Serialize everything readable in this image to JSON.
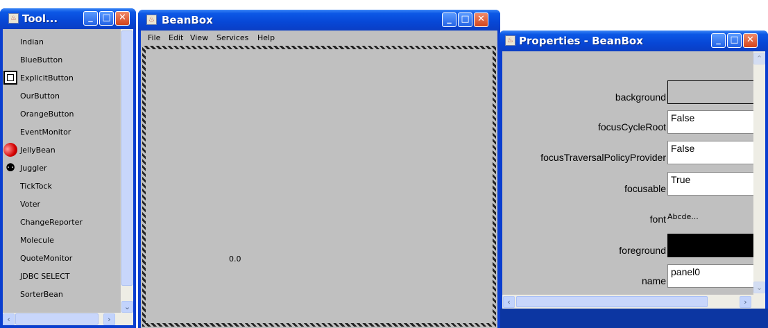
{
  "toolbox": {
    "title": "Tool...",
    "items": [
      {
        "label": "Indian",
        "icon": ""
      },
      {
        "label": "BlueButton",
        "icon": ""
      },
      {
        "label": "ExplicitButton",
        "icon": "button-frame-icon"
      },
      {
        "label": "OurButton",
        "icon": ""
      },
      {
        "label": "OrangeButton",
        "icon": ""
      },
      {
        "label": "EventMonitor",
        "icon": ""
      },
      {
        "label": "JellyBean",
        "icon": "jellybean-icon"
      },
      {
        "label": "Juggler",
        "icon": "juggler-icon"
      },
      {
        "label": "TickTock",
        "icon": ""
      },
      {
        "label": "Voter",
        "icon": ""
      },
      {
        "label": "ChangeReporter",
        "icon": ""
      },
      {
        "label": "Molecule",
        "icon": ""
      },
      {
        "label": "QuoteMonitor",
        "icon": ""
      },
      {
        "label": "JDBC SELECT",
        "icon": ""
      },
      {
        "label": "SorterBean",
        "icon": ""
      }
    ]
  },
  "beanbox": {
    "title": "BeanBox",
    "menu": [
      "File",
      "Edit",
      "View",
      "Services",
      "Help"
    ],
    "canvas_value": "0.0"
  },
  "properties": {
    "title": "Properties - BeanBox",
    "rows": [
      {
        "label": "background",
        "value": "",
        "kind": "color",
        "color": "#c0c0c0"
      },
      {
        "label": "focusCycleRoot",
        "value": "False",
        "kind": "text"
      },
      {
        "label": "focusTraversalPolicyProvider",
        "value": "False",
        "kind": "text"
      },
      {
        "label": "focusable",
        "value": "True",
        "kind": "text"
      },
      {
        "label": "font",
        "value": "Abcde...",
        "kind": "font"
      },
      {
        "label": "foreground",
        "value": "",
        "kind": "color",
        "color": "#000000"
      },
      {
        "label": "name",
        "value": "panel0",
        "kind": "text"
      }
    ]
  },
  "window_controls": {
    "minimize": "_",
    "maximize": "□",
    "close": "✕"
  },
  "colors": {
    "titlebar": "#0747d6",
    "client": "#c0c0c0",
    "desktop": "#0c36a2"
  }
}
